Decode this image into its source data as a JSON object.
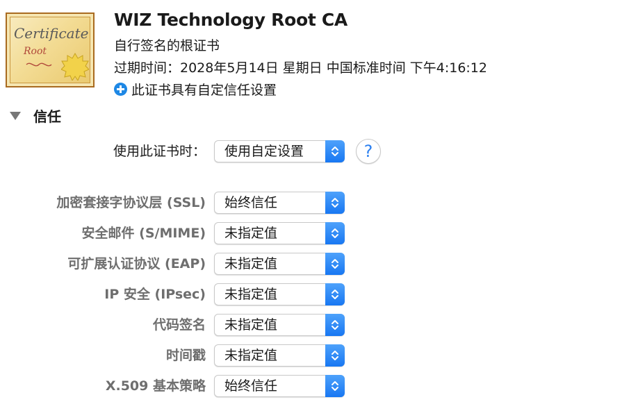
{
  "certificate": {
    "icon_title": "Certificate",
    "icon_subtitle": "Root",
    "name": "WIZ Technology Root CA",
    "type": "自行签名的根证书",
    "expiry": "过期时间：2028年5月14日 星期日 中国标准时间 下午4:16:12",
    "custom_trust": "此证书具有自定信任设置"
  },
  "trust": {
    "section_label": "信任",
    "when_using": {
      "label": "使用此证书时：",
      "value": "使用自定设置"
    },
    "help_label": "?",
    "rows": [
      {
        "label": "加密套接字协议层 (SSL)",
        "value": "始终信任"
      },
      {
        "label": "安全邮件 (S/MIME)",
        "value": "未指定值"
      },
      {
        "label": "可扩展认证协议 (EAP)",
        "value": "未指定值"
      },
      {
        "label": "IP 安全 (IPsec)",
        "value": "未指定值"
      },
      {
        "label": "代码签名",
        "value": "未指定值"
      },
      {
        "label": "时间戳",
        "value": "未指定值"
      },
      {
        "label": "X.509 基本策略",
        "value": "始终信任"
      }
    ]
  },
  "colors": {
    "accent": "#1877f2",
    "dim_label": "#6e6e6e"
  }
}
